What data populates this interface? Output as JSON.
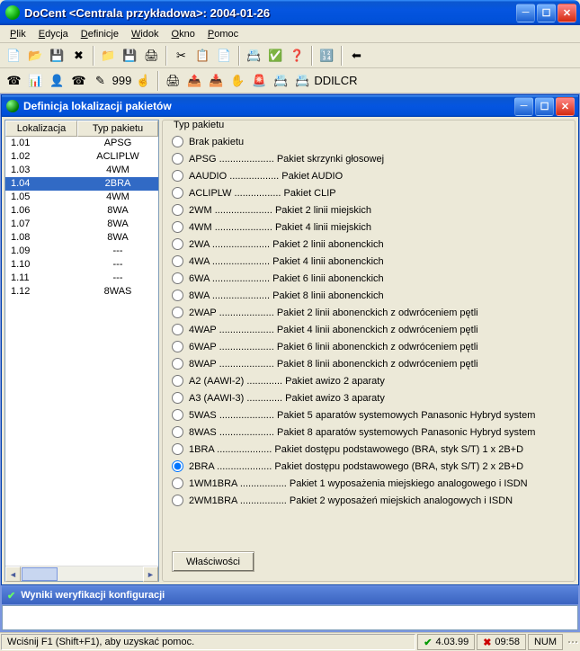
{
  "title": "DoCent <Centrala przykładowa>: 2004-01-26",
  "menu": [
    "Plik",
    "Edycja",
    "Definicje",
    "Widok",
    "Okno",
    "Pomoc"
  ],
  "toolbar1": [
    "📄",
    "📂",
    "💾",
    "✖",
    "📁",
    "💾",
    "🖨",
    "✂",
    "📋",
    "📄",
    "📇",
    "✅",
    "❓",
    "🔢",
    "⬅"
  ],
  "toolbar2": [
    "☎",
    "📊",
    "👤",
    "☎",
    "✎",
    "999",
    "☝",
    "🖨",
    "📤",
    "📥",
    "✋",
    "🚨",
    "📇",
    "📇",
    "DDI",
    "LCR"
  ],
  "inner_title": "Definicja lokalizacji pakietów",
  "grid": {
    "headers": {
      "loc": "Lokalizacja",
      "type": "Typ pakietu"
    },
    "rows": [
      {
        "loc": "1.01",
        "type": "APSG"
      },
      {
        "loc": "1.02",
        "type": "ACLIPLW"
      },
      {
        "loc": "1.03",
        "type": "4WM"
      },
      {
        "loc": "1.04",
        "type": "2BRA",
        "selected": true
      },
      {
        "loc": "1.05",
        "type": "4WM"
      },
      {
        "loc": "1.06",
        "type": "8WA"
      },
      {
        "loc": "1.07",
        "type": "8WA"
      },
      {
        "loc": "1.08",
        "type": "8WA"
      },
      {
        "loc": "1.09",
        "type": "---"
      },
      {
        "loc": "1.10",
        "type": "---"
      },
      {
        "loc": "1.11",
        "type": "---"
      },
      {
        "loc": "1.12",
        "type": "8WAS"
      }
    ]
  },
  "group_label": "Typ pakietu",
  "radios": [
    {
      "code": "",
      "label": "Brak pakietu"
    },
    {
      "code": "APSG",
      "label": "Pakiet skrzynki głosowej"
    },
    {
      "code": "AAUDIO",
      "label": "Pakiet AUDIO"
    },
    {
      "code": "ACLIPLW",
      "label": "Pakiet CLIP"
    },
    {
      "code": "2WM",
      "label": "Pakiet 2 linii miejskich"
    },
    {
      "code": "4WM",
      "label": "Pakiet 4 linii miejskich"
    },
    {
      "code": "2WA",
      "label": "Pakiet 2 linii abonenckich"
    },
    {
      "code": "4WA",
      "label": "Pakiet 4 linii abonenckich"
    },
    {
      "code": "6WA",
      "label": "Pakiet 6 linii abonenckich"
    },
    {
      "code": "8WA",
      "label": "Pakiet 8 linii abonenckich"
    },
    {
      "code": "2WAP",
      "label": "Pakiet 2 linii abonenckich z odwróceniem pętli"
    },
    {
      "code": "4WAP",
      "label": "Pakiet 4 linii abonenckich z odwróceniem pętli"
    },
    {
      "code": "6WAP",
      "label": "Pakiet 6 linii abonenckich z odwróceniem pętli"
    },
    {
      "code": "8WAP",
      "label": "Pakiet 8 linii abonenckich z odwróceniem pętli"
    },
    {
      "code": "A2 (AAWI-2)",
      "label": "Pakiet awizo 2 aparaty"
    },
    {
      "code": "A3 (AAWI-3)",
      "label": "Pakiet awizo 3 aparaty"
    },
    {
      "code": "5WAS",
      "label": "Pakiet 5 aparatów systemowych Panasonic Hybryd system"
    },
    {
      "code": "8WAS",
      "label": "Pakiet 8 aparatów systemowych Panasonic Hybryd system"
    },
    {
      "code": "1BRA",
      "label": "Pakiet dostępu podstawowego (BRA, styk S/T) 1 x 2B+D"
    },
    {
      "code": "2BRA",
      "label": "Pakiet dostępu podstawowego (BRA, styk S/T) 2 x 2B+D",
      "checked": true
    },
    {
      "code": "1WM1BRA",
      "label": "Pakiet 1 wyposażenia miejskiego analogowego i ISDN"
    },
    {
      "code": "2WM1BRA",
      "label": "Pakiet 2 wyposażeń miejskich analogowych i ISDN"
    }
  ],
  "props_button": "Właściwości",
  "results_title": "Wyniki weryfikacji konfiguracji",
  "status": {
    "hint": "Wciśnij F1 (Shift+F1), aby uzyskać pomoc.",
    "version": "4.03.99",
    "time": "09:58",
    "num": "NUM"
  }
}
